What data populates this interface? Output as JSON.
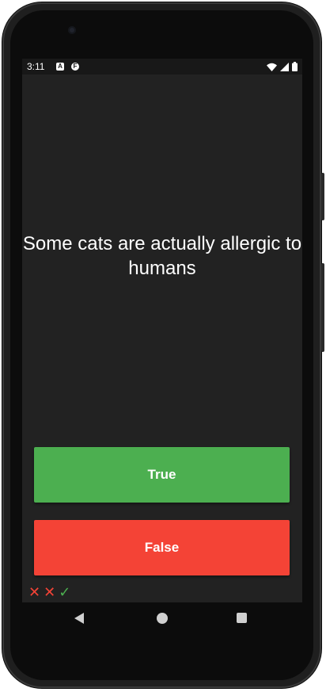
{
  "status_bar": {
    "time": "3:11",
    "notification_icons": [
      "A",
      "F"
    ],
    "right_icons": [
      "wifi-icon",
      "signal-icon",
      "battery-icon"
    ]
  },
  "quiz": {
    "question": "Some cats are actually allergic to humans",
    "true_label": "True",
    "false_label": "False"
  },
  "history": [
    {
      "symbol": "✕",
      "result": "wrong",
      "icon": "cross-icon"
    },
    {
      "symbol": "✕",
      "result": "wrong",
      "icon": "cross-icon"
    },
    {
      "symbol": "✓",
      "result": "right",
      "icon": "check-icon"
    }
  ],
  "navigation": {
    "icons": [
      "back-icon",
      "home-icon",
      "recents-icon"
    ]
  },
  "colors": {
    "true_button": "#4caf50",
    "false_button": "#f44336",
    "screen_background": "#222222",
    "correct": "#4caf50",
    "wrong": "#f44336"
  }
}
